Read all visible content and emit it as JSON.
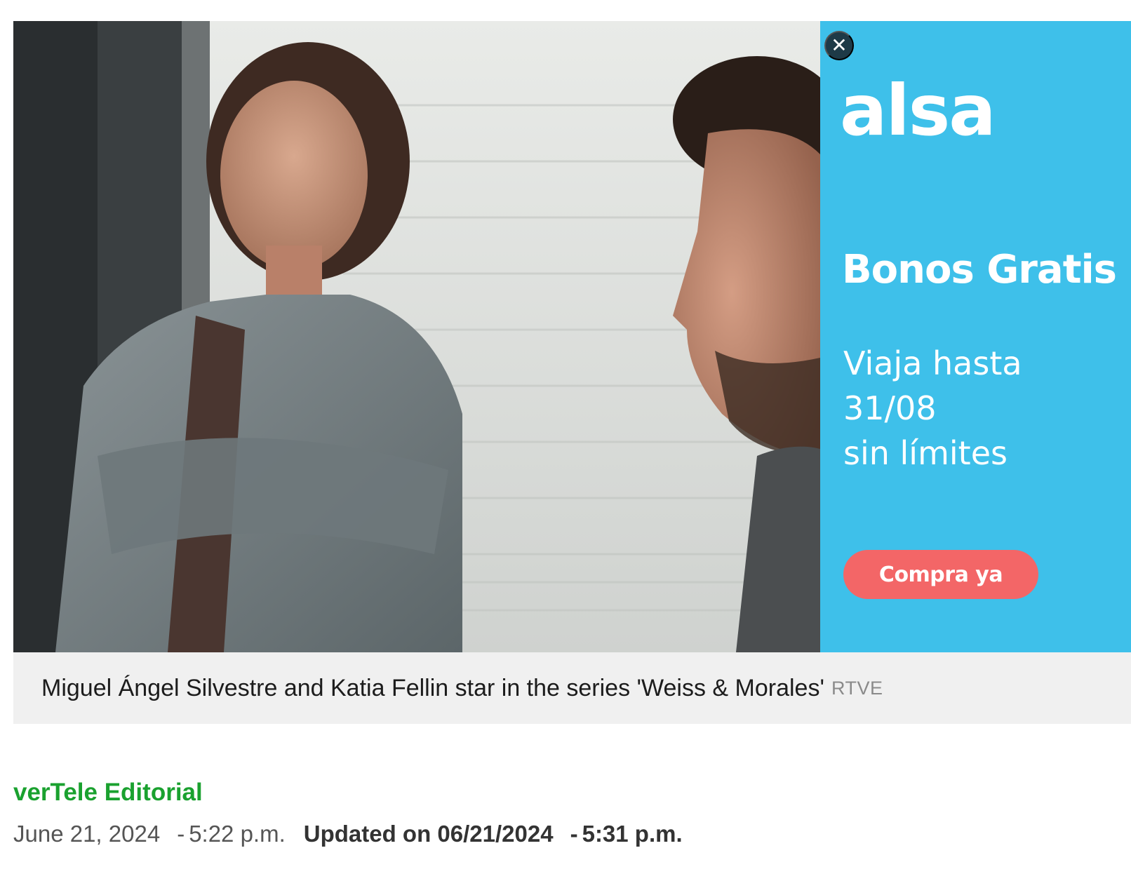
{
  "hero": {
    "caption": "Miguel Ángel Silvestre and Katia Fellin star in the series 'Weiss & Morales'",
    "credit": "RTVE"
  },
  "ad": {
    "close_glyph": "✕",
    "logo": "alsa",
    "headline": "Bonos Gratis",
    "sub_line1": "Viaja hasta 31/08",
    "sub_line2": "sin límites",
    "cta": "Compra ya",
    "colors": {
      "background": "#3ec0ea",
      "cta": "#f36667",
      "close": "#1e3a47"
    }
  },
  "byline": {
    "author": "verTele Editorial",
    "date": "June 21, 2024",
    "time": "5:22 p.m.",
    "updated_label": "Updated on 06/21/2024",
    "updated_time": "5:31 p.m.",
    "separator": "-",
    "colors": {
      "author": "#1aa12f"
    }
  }
}
